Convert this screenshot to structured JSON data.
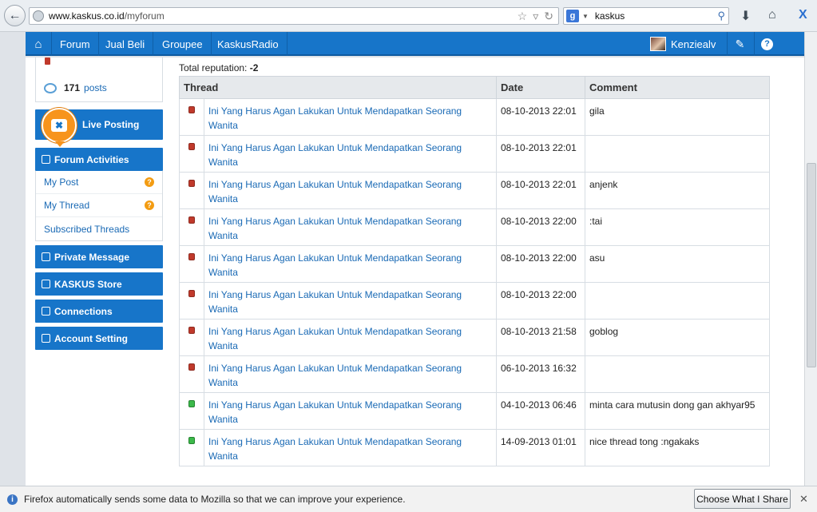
{
  "browser": {
    "url_host": "www.kaskus.co.id",
    "url_path": "/myforum",
    "search_query": "kaskus",
    "search_engine_icon": "g-icon"
  },
  "nav": {
    "items": [
      "Forum",
      "Jual Beli",
      "Groupee",
      "KaskusRadio"
    ],
    "username": "Kenziealv"
  },
  "sidebar": {
    "post_count": "171",
    "post_label": "posts",
    "live_posting": "Live Posting",
    "forum_activities": "Forum Activities",
    "my_post": "My Post",
    "my_thread": "My Thread",
    "subscribed_threads": "Subscribed Threads",
    "private_message": "Private Message",
    "kaskus_store": "KASKUS Store",
    "connections": "Connections",
    "account_setting": "Account Setting"
  },
  "main": {
    "reputation_label": "Total reputation:",
    "reputation_value": "-2",
    "columns": [
      "Thread",
      "Date",
      "Comment"
    ],
    "rows": [
      {
        "status": "red",
        "thread": "Ini Yang Harus Agan Lakukan Untuk Mendapatkan Seorang Wanita",
        "date": "08-10-2013 22:01",
        "comment": "gila"
      },
      {
        "status": "red",
        "thread": "Ini Yang Harus Agan Lakukan Untuk Mendapatkan Seorang Wanita",
        "date": "08-10-2013 22:01",
        "comment": ""
      },
      {
        "status": "red",
        "thread": "Ini Yang Harus Agan Lakukan Untuk Mendapatkan Seorang Wanita",
        "date": "08-10-2013 22:01",
        "comment": "anjenk"
      },
      {
        "status": "red",
        "thread": "Ini Yang Harus Agan Lakukan Untuk Mendapatkan Seorang Wanita",
        "date": "08-10-2013 22:00",
        "comment": ":tai"
      },
      {
        "status": "red",
        "thread": "Ini Yang Harus Agan Lakukan Untuk Mendapatkan Seorang Wanita",
        "date": "08-10-2013 22:00",
        "comment": "asu"
      },
      {
        "status": "red",
        "thread": "Ini Yang Harus Agan Lakukan Untuk Mendapatkan Seorang Wanita",
        "date": "08-10-2013 22:00",
        "comment": ""
      },
      {
        "status": "red",
        "thread": "Ini Yang Harus Agan Lakukan Untuk Mendapatkan Seorang Wanita",
        "date": "08-10-2013 21:58",
        "comment": "goblog"
      },
      {
        "status": "red",
        "thread": "Ini Yang Harus Agan Lakukan Untuk Mendapatkan Seorang Wanita",
        "date": "06-10-2013 16:32",
        "comment": ""
      },
      {
        "status": "green",
        "thread": "Ini Yang Harus Agan Lakukan Untuk Mendapatkan Seorang Wanita",
        "date": "04-10-2013 06:46",
        "comment": "minta cara mutusin dong gan akhyar95"
      },
      {
        "status": "green",
        "thread": "Ini Yang Harus Agan Lakukan Untuk Mendapatkan Seorang Wanita",
        "date": "14-09-2013 01:01",
        "comment": "nice thread tong :ngakaks"
      }
    ]
  },
  "notification": {
    "text": "Firefox automatically sends some data to Mozilla so that we can improve your experience.",
    "button": "Choose What I Share"
  },
  "colors": {
    "brand": "#1775c9",
    "accent": "#f7941d",
    "link": "#1a6ab5",
    "status_red": "#c0392b",
    "status_green": "#3cb94a"
  }
}
